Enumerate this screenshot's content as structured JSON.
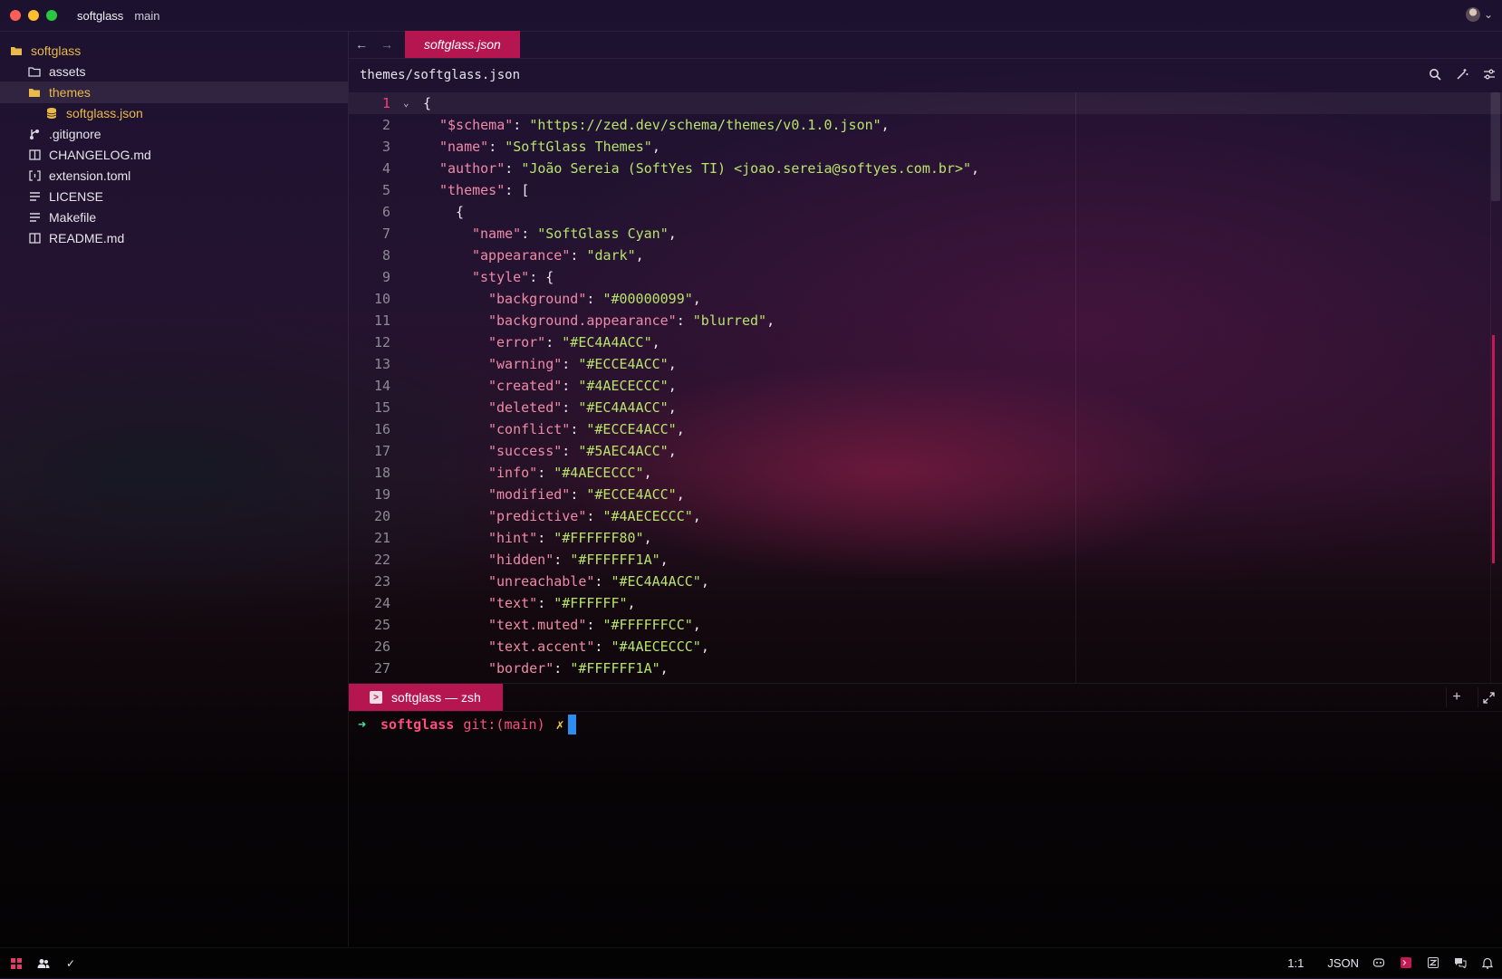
{
  "titlebar": {
    "project": "softglass",
    "branch": "main"
  },
  "sidebar": {
    "items": [
      {
        "label": "softglass",
        "icon": "folder-open-icon"
      },
      {
        "label": "assets",
        "icon": "folder-icon"
      },
      {
        "label": "themes",
        "icon": "folder-open-icon"
      },
      {
        "label": "softglass.json",
        "icon": "database-icon"
      },
      {
        "label": ".gitignore",
        "icon": "git-icon"
      },
      {
        "label": "CHANGELOG.md",
        "icon": "book-icon"
      },
      {
        "label": "extension.toml",
        "icon": "brackets-icon"
      },
      {
        "label": "LICENSE",
        "icon": "lines-icon"
      },
      {
        "label": "Makefile",
        "icon": "lines-icon"
      },
      {
        "label": "README.md",
        "icon": "book-icon"
      }
    ]
  },
  "tabs": {
    "active": "softglass.json"
  },
  "breadcrumb": {
    "path": "themes/softglass.json"
  },
  "editor": {
    "lines": [
      {
        "num": "1",
        "code": "{"
      },
      {
        "num": "2",
        "key": "\"$schema\"",
        "val": "\"https://zed.dev/schema/themes/v0.1.0.json\"",
        "end": ","
      },
      {
        "num": "3",
        "key": "\"name\"",
        "val": "\"SoftGlass Themes\"",
        "end": ","
      },
      {
        "num": "4",
        "key": "\"author\"",
        "val": "\"João Sereia (SoftYes TI) <joao.sereia@softyes.com.br>\"",
        "end": ","
      },
      {
        "num": "5",
        "key": "\"themes\"",
        "val": "",
        "end": "["
      },
      {
        "num": "6",
        "code": "{"
      },
      {
        "num": "7",
        "key": "\"name\"",
        "val": "\"SoftGlass Cyan\"",
        "end": ","
      },
      {
        "num": "8",
        "key": "\"appearance\"",
        "val": "\"dark\"",
        "end": ","
      },
      {
        "num": "9",
        "key": "\"style\"",
        "val": "",
        "end": "{"
      },
      {
        "num": "10",
        "key": "\"background\"",
        "val": "\"#00000099\"",
        "end": ","
      },
      {
        "num": "11",
        "key": "\"background.appearance\"",
        "val": "\"blurred\"",
        "end": ","
      },
      {
        "num": "12",
        "key": "\"error\"",
        "val": "\"#EC4A4ACC\"",
        "end": ","
      },
      {
        "num": "13",
        "key": "\"warning\"",
        "val": "\"#ECCE4ACC\"",
        "end": ","
      },
      {
        "num": "14",
        "key": "\"created\"",
        "val": "\"#4AECECCC\"",
        "end": ","
      },
      {
        "num": "15",
        "key": "\"deleted\"",
        "val": "\"#EC4A4ACC\"",
        "end": ","
      },
      {
        "num": "16",
        "key": "\"conflict\"",
        "val": "\"#ECCE4ACC\"",
        "end": ","
      },
      {
        "num": "17",
        "key": "\"success\"",
        "val": "\"#5AEC4ACC\"",
        "end": ","
      },
      {
        "num": "18",
        "key": "\"info\"",
        "val": "\"#4AECECCC\"",
        "end": ","
      },
      {
        "num": "19",
        "key": "\"modified\"",
        "val": "\"#ECCE4ACC\"",
        "end": ","
      },
      {
        "num": "20",
        "key": "\"predictive\"",
        "val": "\"#4AECECCC\"",
        "end": ","
      },
      {
        "num": "21",
        "key": "\"hint\"",
        "val": "\"#FFFFFF80\"",
        "end": ","
      },
      {
        "num": "22",
        "key": "\"hidden\"",
        "val": "\"#FFFFFF1A\"",
        "end": ","
      },
      {
        "num": "23",
        "key": "\"unreachable\"",
        "val": "\"#EC4A4ACC\"",
        "end": ","
      },
      {
        "num": "24",
        "key": "\"text\"",
        "val": "\"#FFFFFF\"",
        "end": ","
      },
      {
        "num": "25",
        "key": "\"text.muted\"",
        "val": "\"#FFFFFFCC\"",
        "end": ","
      },
      {
        "num": "26",
        "key": "\"text.accent\"",
        "val": "\"#4AECECCC\"",
        "end": ","
      },
      {
        "num": "27",
        "key": "\"border\"",
        "val": "\"#FFFFFF1A\"",
        "end": ","
      }
    ]
  },
  "terminal": {
    "tab_label": "softglass — zsh",
    "prompt_arrow": "➜",
    "prompt_dir": "softglass",
    "prompt_git": "git:(main)",
    "prompt_dirty": "✗"
  },
  "statusbar": {
    "cursor_position": "1:1",
    "language": "JSON"
  },
  "colors": {
    "accent": "#b5164f",
    "folder": "#e9b949",
    "string": "#b7e36b",
    "key": "#f08aa8",
    "line_number_current": "#ff3f7a",
    "terminal_cursor": "#2e8cf0"
  }
}
